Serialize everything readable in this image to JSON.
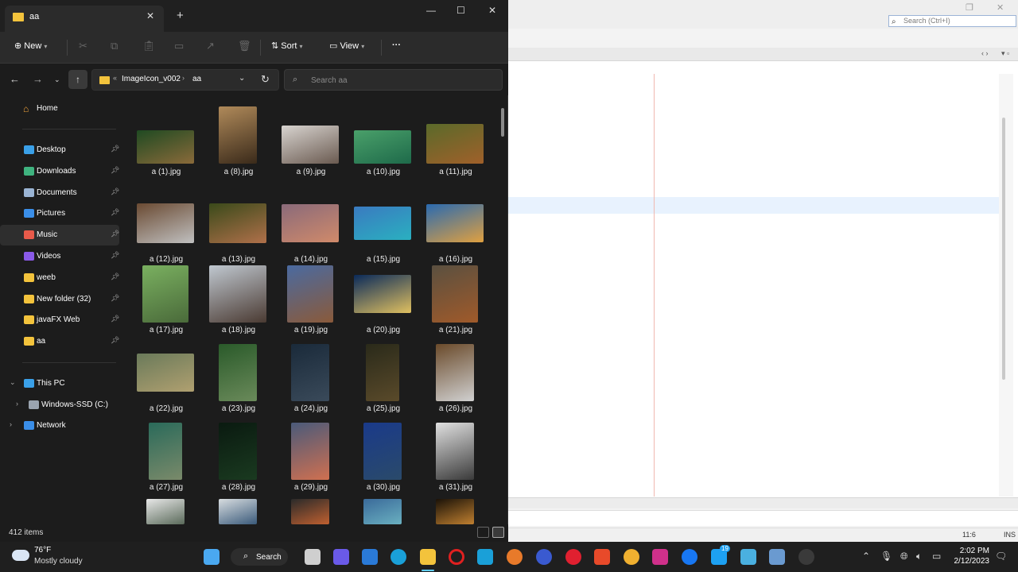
{
  "ide": {
    "search_placeholder": "Search (Ctrl+I)",
    "caret_position": "11:6",
    "insert_mode": "INS"
  },
  "explorer": {
    "tab_title": "aa",
    "toolbar": {
      "new_label": "New",
      "sort_label": "Sort",
      "view_label": "View",
      "more_label": "···"
    },
    "address": {
      "crumbs": [
        "ImageIcon_v002",
        "aa"
      ],
      "overflow": "«"
    },
    "search_placeholder": "Search aa",
    "sidebar": {
      "home": "Home",
      "pinned": [
        {
          "label": "Desktop",
          "icon": "desktop-icon",
          "color": "#3aa0e8"
        },
        {
          "label": "Downloads",
          "icon": "download-icon",
          "color": "#3fb37f"
        },
        {
          "label": "Documents",
          "icon": "document-icon",
          "color": "#9ab4d4"
        },
        {
          "label": "Pictures",
          "icon": "pictures-icon",
          "color": "#3a8ee8"
        },
        {
          "label": "Music",
          "icon": "music-icon",
          "color": "#e85a4a"
        },
        {
          "label": "Videos",
          "icon": "videos-icon",
          "color": "#8a5ae8"
        },
        {
          "label": "weeb",
          "icon": "folder-icon",
          "color": "#f3c33c"
        },
        {
          "label": "New folder (32)",
          "icon": "folder-icon",
          "color": "#f3c33c"
        },
        {
          "label": "javaFX Web",
          "icon": "folder-icon",
          "color": "#f3c33c"
        },
        {
          "label": "aa",
          "icon": "folder-icon",
          "color": "#f3c33c"
        }
      ],
      "this_pc": "This PC",
      "drive": "Windows-SSD (C:)",
      "network": "Network"
    },
    "files": [
      {
        "name": "a (1).jpg",
        "c1": "#1f4a22",
        "c2": "#8a6a3a"
      },
      {
        "name": "a (8).jpg",
        "c1": "#b08a5a",
        "c2": "#3a2a1a"
      },
      {
        "name": "a (9).jpg",
        "c1": "#d8d4d0",
        "c2": "#6a5a50"
      },
      {
        "name": "a (10).jpg",
        "c1": "#4aa06a",
        "c2": "#1e6a4a"
      },
      {
        "name": "a (11).jpg",
        "c1": "#5a6a2a",
        "c2": "#a0602a"
      },
      {
        "name": "a (12).jpg",
        "c1": "#6a4a32",
        "c2": "#c0c0c0"
      },
      {
        "name": "a (13).jpg",
        "c1": "#3a4a1a",
        "c2": "#b0704a"
      },
      {
        "name": "a (14).jpg",
        "c1": "#8a6a7a",
        "c2": "#d08a6a"
      },
      {
        "name": "a (15).jpg",
        "c1": "#3a7ac0",
        "c2": "#2ab0c0"
      },
      {
        "name": "a (16).jpg",
        "c1": "#2a6ab0",
        "c2": "#e0a040"
      },
      {
        "name": "a (17).jpg",
        "c1": "#7ab060",
        "c2": "#4a6a3a"
      },
      {
        "name": "a (18).jpg",
        "c1": "#c0c8d0",
        "c2": "#4a3a32"
      },
      {
        "name": "a (19).jpg",
        "c1": "#4a6aa0",
        "c2": "#8a5a3a"
      },
      {
        "name": "a (20).jpg",
        "c1": "#0a2a5a",
        "c2": "#e0c060"
      },
      {
        "name": "a (21).jpg",
        "c1": "#5a5040",
        "c2": "#a05a2a"
      },
      {
        "name": "a (22).jpg",
        "c1": "#6a7a5a",
        "c2": "#b0a070"
      },
      {
        "name": "a (23).jpg",
        "c1": "#2a5a2a",
        "c2": "#6a8a5a"
      },
      {
        "name": "a (24).jpg",
        "c1": "#1a2a3a",
        "c2": "#3a4a5a"
      },
      {
        "name": "a (25).jpg",
        "c1": "#2a2a1a",
        "c2": "#5a4a2a"
      },
      {
        "name": "a (26).jpg",
        "c1": "#6a4a2a",
        "c2": "#d0d0d0"
      },
      {
        "name": "a (27).jpg",
        "c1": "#2a6a5a",
        "c2": "#7a8a6a"
      },
      {
        "name": "a (28).jpg",
        "c1": "#0a1a10",
        "c2": "#1a3a20"
      },
      {
        "name": "a (29).jpg",
        "c1": "#4a5a7a",
        "c2": "#d07050"
      },
      {
        "name": "a (30).jpg",
        "c1": "#1a3a8a",
        "c2": "#2a4a6a"
      },
      {
        "name": "a (31).jpg",
        "c1": "#e0e0e0",
        "c2": "#3a3a3a"
      },
      {
        "name": "",
        "c1": "#e8e8e8",
        "c2": "#5a6a5a"
      },
      {
        "name": "",
        "c1": "#d8dde0",
        "c2": "#3a5a7a"
      },
      {
        "name": "",
        "c1": "#2a2a2a",
        "c2": "#c06030"
      },
      {
        "name": "",
        "c1": "#3a6a9a",
        "c2": "#6ab0c0"
      },
      {
        "name": "",
        "c1": "#1a1208",
        "c2": "#c08030"
      }
    ],
    "status": {
      "item_count": "412 items"
    }
  },
  "taskbar": {
    "weather_temp": "76°F",
    "weather_desc": "Mostly cloudy",
    "search_label": "Search",
    "time": "2:02 PM",
    "date": "2/12/2023",
    "badge_count": "19"
  }
}
